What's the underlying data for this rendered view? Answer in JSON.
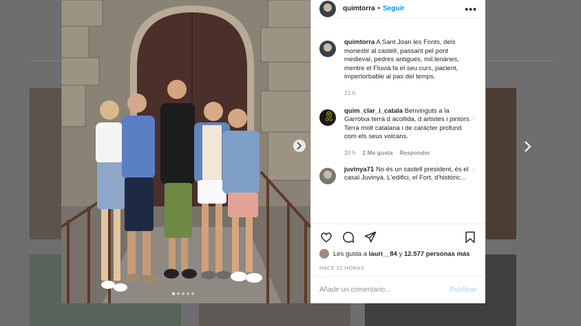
{
  "post": {
    "username": "quimtorra",
    "follow_label": "Seguir",
    "separator": "•",
    "more": "•••"
  },
  "comments": [
    {
      "username": "quimtorra",
      "text": "A Sant Joan les Fonts, dels monestir al castell, passant pel pont medieval, pedres antigues, mil.lenàries, mentre el Fluvià fa el seu curs, pacient, impertorbable al pas del temps.",
      "time": "21 h"
    },
    {
      "username": "quim_clar_i_catala",
      "text": "Benvinguts a la Garrotxa terra d acollida, d artistes i pintors. Terra molt catalana i de caràcter profund com els seus volcans.",
      "time": "20 h",
      "likes": "2 Me gusta",
      "reply": "Responder"
    },
    {
      "username": "juvinya71",
      "text": "No és un castell president, és el casal Juvinyà. L'edifici, el Fort, d'històric..."
    }
  ],
  "likes": {
    "prefix": "Les gusta a",
    "user": "lauri__84",
    "connector": "y",
    "others": "12.577 personas más"
  },
  "timestamp": "HACE 21 HORAS",
  "add_comment": {
    "placeholder": "Añade un comentario...",
    "publish_label": "Publicar"
  },
  "colors": {
    "link": "#0095f6",
    "publish_disabled": "#b2dffc"
  },
  "icons": [
    "heart-icon",
    "comment-icon",
    "share-icon",
    "bookmark-icon",
    "chevron-right-icon"
  ]
}
